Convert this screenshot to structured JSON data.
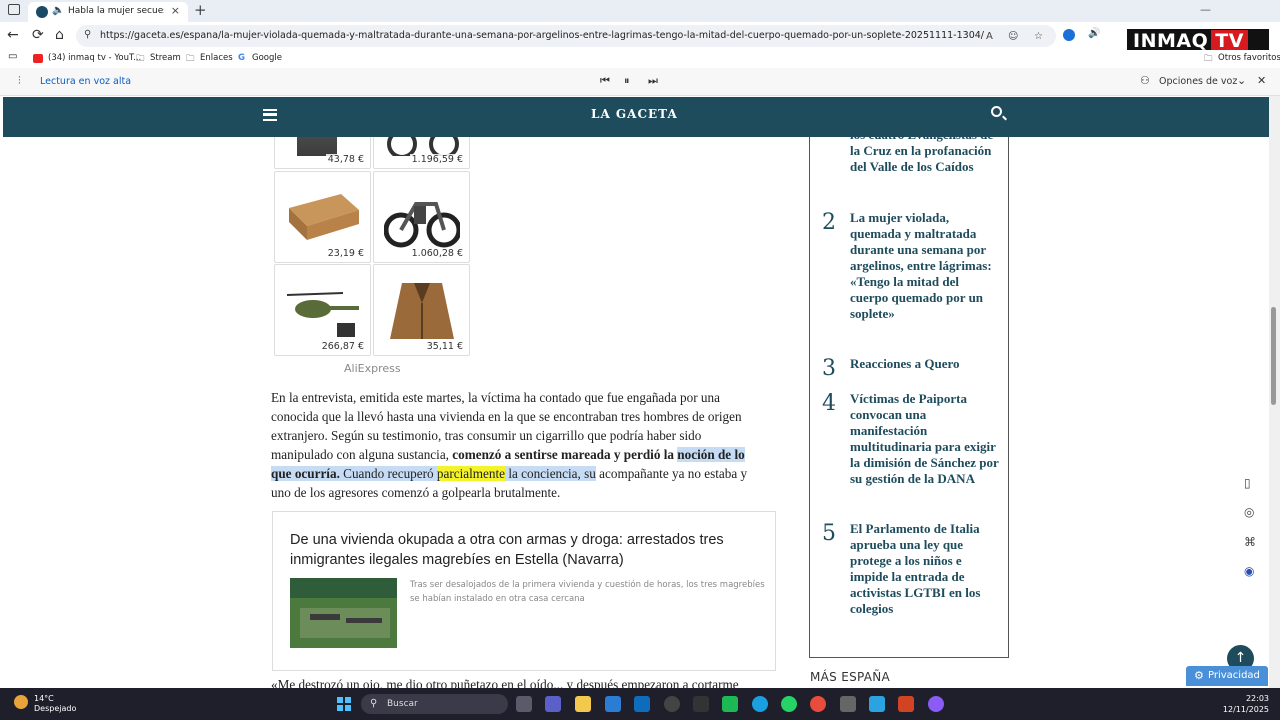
{
  "browser": {
    "tab_title": "Habla la mujer secuestrada,",
    "tab_close": "×",
    "new_tab": "+",
    "url": "https://gaceta.es/espana/la-mujer-violada-quemada-y-maltratada-durante-una-semana-por-argelinos-entre-lagrimas-tengo-la-mitad-del-cuerpo-quemado-por-un-soplete-20251111-1304/",
    "bookmarks": [
      "(34) inmaq tv - YouT...",
      "Stream",
      "Enlaces",
      "Google"
    ],
    "other_favorites": "Otros favoritos"
  },
  "read_aloud": {
    "label": "Lectura en voz alta",
    "voice_options": "Opciones de voz"
  },
  "site": {
    "brand": "LA GACETA"
  },
  "products": [
    {
      "price": "43,78 €"
    },
    {
      "price": "1.196,59 €"
    },
    {
      "price": "23,19 €"
    },
    {
      "price": "1.060,28 €"
    },
    {
      "price": "266,87 €"
    },
    {
      "price": "35,11 €"
    }
  ],
  "aliexpress_label": "AliExpress",
  "article": {
    "para1_a": "En la entrevista, emitida este martes, la víctima ha contado que fue engañada por una conocida que la llevó hasta una vivienda en la que se encontraban tres hombres de origen extranjero. Según su testimonio, tras consumir un cigarrillo que podría haber sido manipulado con alguna sustancia, ",
    "para1_bold1": "comenzó a sentirse mareada y perdió la",
    "para1_bold2": "noción de lo que ocurría.",
    "para1_hl1": " Cuando recuperó ",
    "para1_yellow": "parcialmente",
    "para1_hl2": " la conciencia, su",
    "para1_end": " acompañante ya no estaba y uno de los agresores comenzó a golpearla brutalmente.",
    "para2": "«Me destrozó un ojo, me dio otro puñetazo en el oído... y después empezaron a cortarme"
  },
  "related": {
    "title": "De una vivienda okupada a otra con armas y droga: arrestados tres inmigrantes ilegales magrebíes en Estella (Navarra)",
    "description": "Tras ser desalojados de la primera vivienda y cuestión de horas, los tres magrebíes se habían instalado en otra casa cercana"
  },
  "most_read": [
    {
      "num": "",
      "text": "los cuatro Evangelistas de la Cruz en la profanación del Valle de los Caídos"
    },
    {
      "num": "2",
      "text": "La mujer violada, quemada y maltratada durante una semana por argelinos, entre lágrimas: «Tengo la mitad del cuerpo quemado por un soplete»"
    },
    {
      "num": "3",
      "text": "Reacciones a Quero"
    },
    {
      "num": "4",
      "text": "Víctimas de Paiporta convocan una manifestación multitudinaria para exigir la dimisión de Sánchez por su gestión de la DANA"
    },
    {
      "num": "5",
      "text": "El Parlamento de Italia aprueba una ley que protege a los niños e impide la entrada de activistas LGTBI en los colegios"
    }
  ],
  "more_section": "MÁS ESPAÑA",
  "privacy_label": "Privacidad",
  "watermark": {
    "brand": "INMAQ",
    "tv": "TV"
  },
  "taskbar": {
    "temp": "14°C",
    "weather": "Despejado",
    "search_placeholder": "Buscar",
    "time": "22:03",
    "date": "12/11/2025"
  }
}
